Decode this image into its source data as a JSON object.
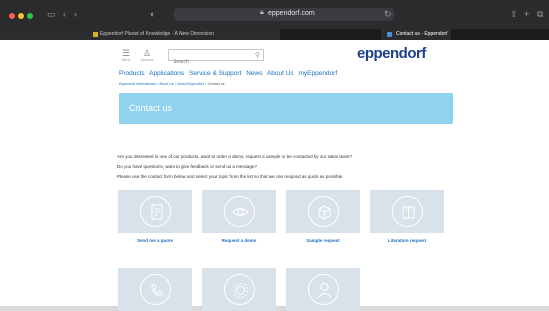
{
  "browser": {
    "url": "eppendorf.com",
    "tabs": [
      {
        "title": "Eppendorf Planet of Knowledge - A New Dimension"
      },
      {
        "title": "Contact us - Eppendorf"
      }
    ]
  },
  "header": {
    "menu_label": "Menu",
    "account_label": "Account",
    "search_placeholder": "Search",
    "logo_text": "eppendorf"
  },
  "nav": {
    "items": [
      {
        "label": "Products"
      },
      {
        "label": "Applications"
      },
      {
        "label": "Service & Support"
      },
      {
        "label": "News"
      },
      {
        "label": "About Us"
      },
      {
        "label": "myEppendorf"
      }
    ]
  },
  "breadcrumb": {
    "items": [
      {
        "label": "Eppendorf International"
      },
      {
        "label": "About Us"
      },
      {
        "label": "About Eppendorf"
      },
      {
        "label": "Contact us"
      }
    ],
    "separator": ">"
  },
  "banner": {
    "title": "Contact us"
  },
  "intro": {
    "lines": [
      "Are you interested in one of our products, want to order a demo, request a sample or be contacted by our sales team?",
      "Do you have questions, want to give feedback or send us a message?",
      "Please use the contact form below and select your topic from the list so that we can respond as quick as possible."
    ]
  },
  "cards": [
    {
      "label": "Send me a quote",
      "icon": "document-icon"
    },
    {
      "label": "Request a demo",
      "icon": "eye-icon"
    },
    {
      "label": "Sample request",
      "icon": "box-icon"
    },
    {
      "label": "Literature request",
      "icon": "book-icon"
    },
    {
      "label": "",
      "icon": "phone-icon"
    },
    {
      "label": "",
      "icon": "service-gear-icon"
    },
    {
      "label": "",
      "icon": "person-icon"
    }
  ],
  "colors": {
    "brand": "#1e3f8a",
    "link": "#1b6ec2",
    "banner": "#8fd3ee",
    "card": "#d9e1eb"
  }
}
